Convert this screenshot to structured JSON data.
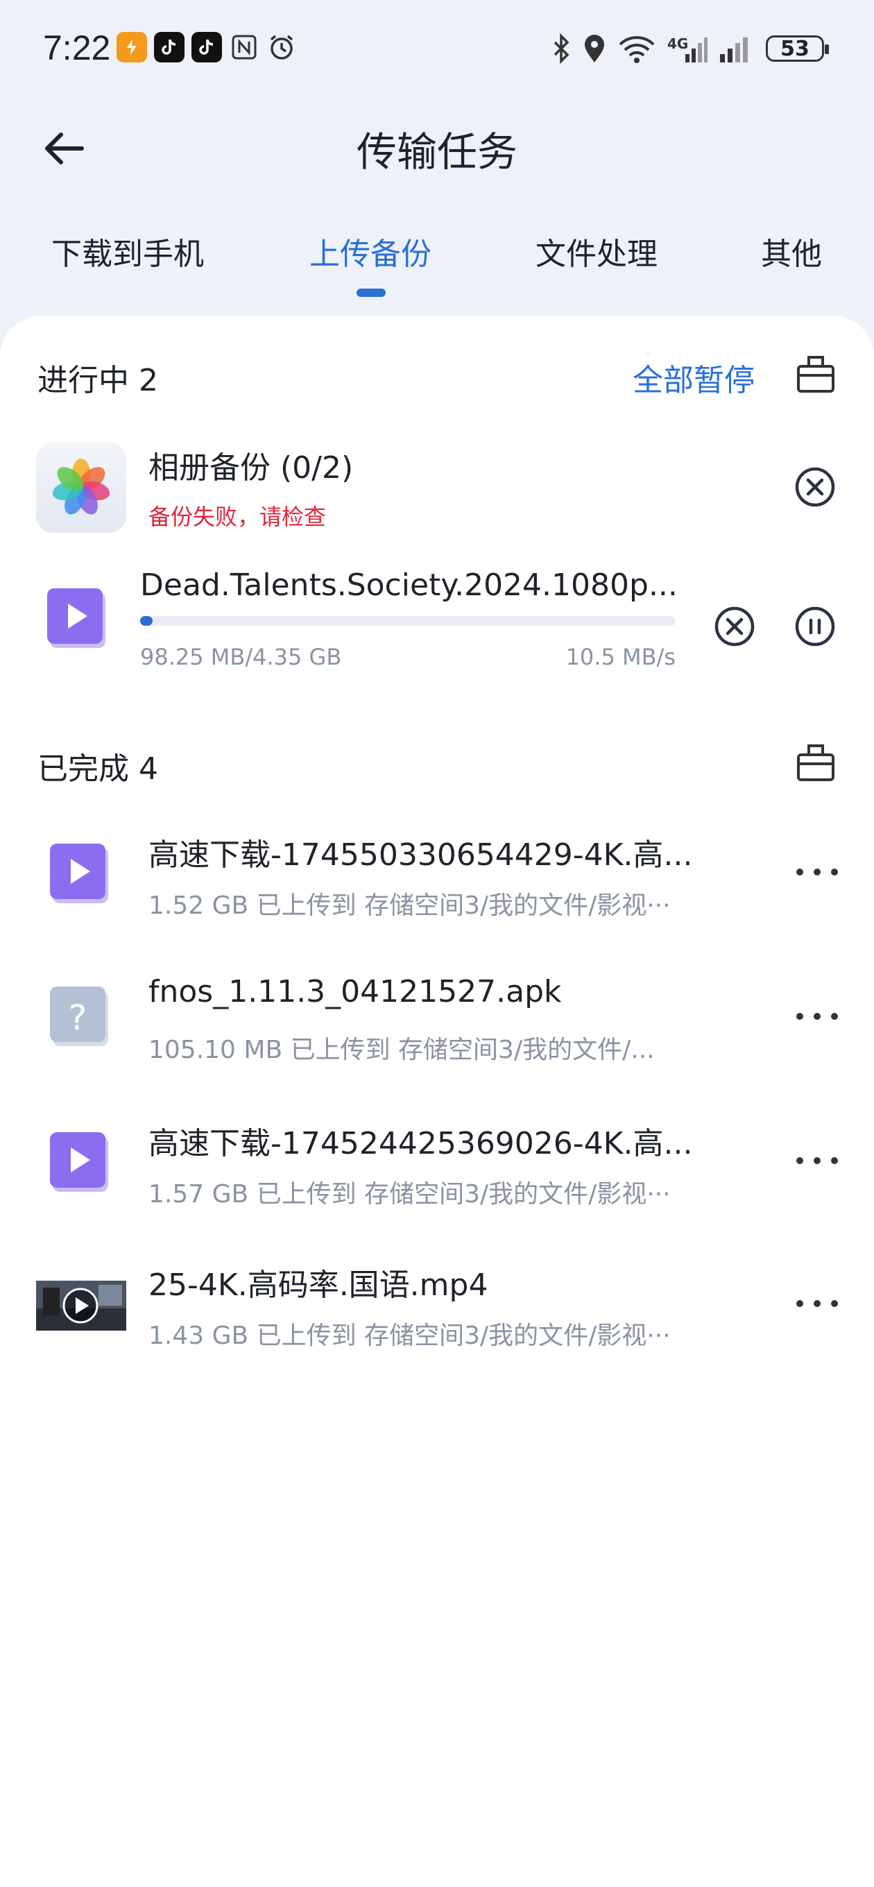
{
  "status_bar": {
    "time": "7:22",
    "battery": "53",
    "network": "4G",
    "icons": [
      "bolt-app-icon",
      "tiktok-icon",
      "tiktok-icon",
      "nfc-icon",
      "alarm-icon",
      "bluetooth-icon",
      "location-icon",
      "wifi-6-icon",
      "signal-4g-icon",
      "signal-icon",
      "battery-icon"
    ]
  },
  "header": {
    "title": "传输任务"
  },
  "tabs": [
    {
      "label": "下载到手机",
      "active": false
    },
    {
      "label": "上传备份",
      "active": true
    },
    {
      "label": "文件处理",
      "active": false
    },
    {
      "label": "其他",
      "active": false
    }
  ],
  "in_progress": {
    "title": "进行中 2",
    "pause_all": "全部暂停",
    "album": {
      "title": "相册备份 (0/2)",
      "error": "备份失败，请检查"
    },
    "upload": {
      "name": "Dead.Talents.Society.2024.1080p...",
      "size": "98.25 MB/4.35 GB",
      "speed": "10.5 MB/s",
      "progress": 0.023
    }
  },
  "completed": {
    "title": "已完成 4",
    "items": [
      {
        "name": "高速下载-174550330654429-4K.高...",
        "meta": "1.52 GB 已上传到 存储空间3/我的文件/影视···",
        "icon": "video-file-icon"
      },
      {
        "name": "fnos_1.11.3_04121527.apk",
        "meta": "105.10 MB 已上传到 存储空间3/我的文件/...",
        "icon": "unknown-file-icon"
      },
      {
        "name": "高速下载-174524425369026-4K.高...",
        "meta": "1.57 GB 已上传到 存储空间3/我的文件/影视···",
        "icon": "video-file-icon"
      },
      {
        "name": "25-4K.高码率.国语.mp4",
        "meta": "1.43 GB 已上传到 存储空间3/我的文件/影视···",
        "icon": "video-thumbnail-icon"
      }
    ]
  },
  "colors": {
    "accent": "#2a6fd6",
    "error": "#e0253a",
    "background": "#eef2f8"
  }
}
